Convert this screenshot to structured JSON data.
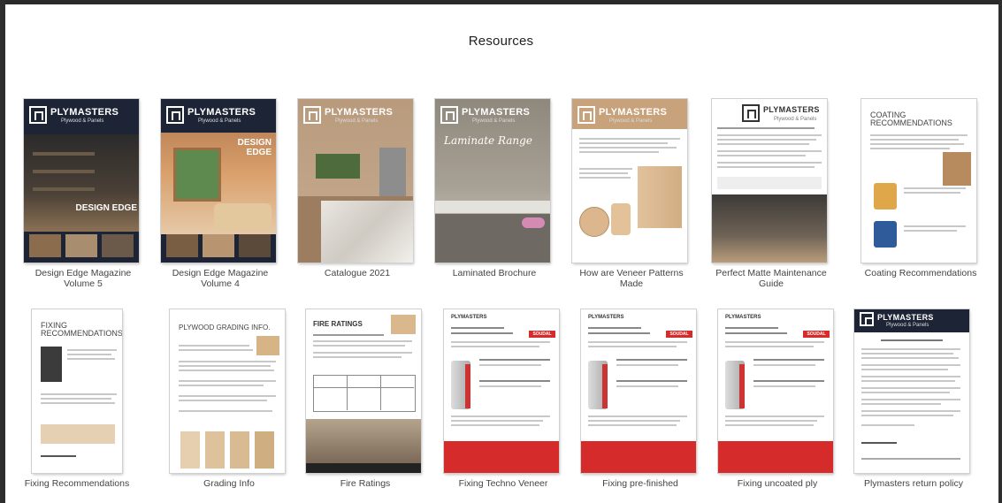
{
  "page": {
    "title": "Resources"
  },
  "cover_text": {
    "plymasters": "PLYMASTERS",
    "plywood_panels": "Plywood & Panels",
    "design_edge": "DESIGN EDGE",
    "laminate_range": "Laminate Range",
    "coating_recommendations": "COATING RECOMMENDATIONS",
    "fixing_recommendations": "FIXING RECOMMENDATIONS",
    "plywood_grading": "PLYWOOD GRADING INFO.",
    "fire_ratings": "FIRE RATINGS",
    "soudal": "SOUDAL"
  },
  "resources": [
    {
      "caption": "Design Edge Magazine Volume 5"
    },
    {
      "caption": "Design Edge Magazine Volume 4"
    },
    {
      "caption": "Catalogue 2021"
    },
    {
      "caption": "Laminated Brochure"
    },
    {
      "caption": "How are Veneer Patterns Made"
    },
    {
      "caption": "Perfect Matte Maintenance Guide"
    },
    {
      "caption": "Coating Recommendations"
    },
    {
      "caption": "Fixing Recommendations"
    },
    {
      "caption": "Grading Info"
    },
    {
      "caption": "Fire Ratings"
    },
    {
      "caption": "Fixing Techno Veneer"
    },
    {
      "caption": "Fixing pre-finished"
    },
    {
      "caption": "Fixing uncoated ply"
    },
    {
      "caption": "Plymasters return policy"
    }
  ],
  "colors": {
    "navy": "#1d2436",
    "wood": "#c8a27a",
    "soudal_red": "#d62b2b"
  }
}
